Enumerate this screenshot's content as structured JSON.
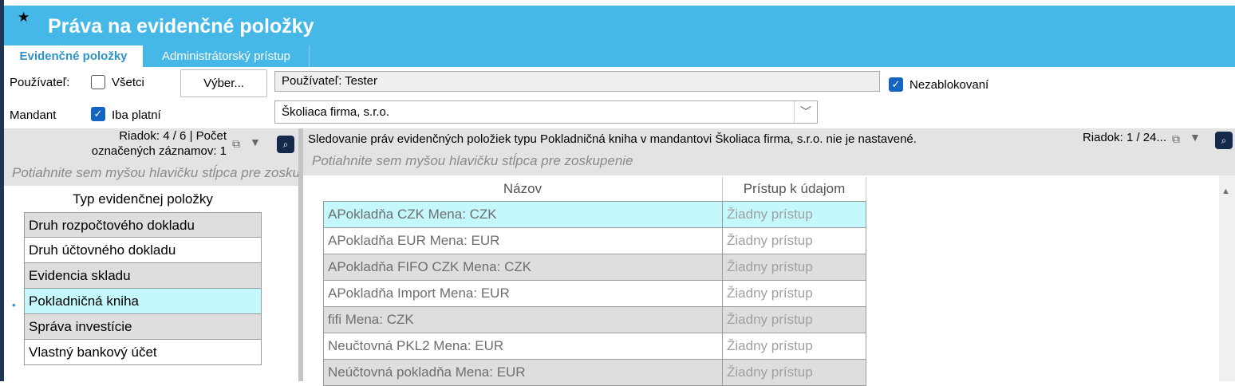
{
  "window": {
    "star": "★",
    "title": "Práva na evidenčné položky",
    "tabs": [
      "Evidenčné položky",
      "Administrátorský prístup"
    ]
  },
  "form": {
    "user_label": "Používateľ:",
    "all_label": "Všetci",
    "all_checked": false,
    "select_button": "Výber...",
    "user_value": "Používateľ: Tester",
    "unblocked_label": "Nezablokovaní",
    "unblocked_checked": true,
    "mandant_label": "Mandant",
    "only_valid_label": "Iba platní",
    "only_valid_checked": true,
    "mandant_value": "Školiaca firma, s.r.o.",
    "dropdown_glyph": "﹀"
  },
  "left_panel": {
    "row_info_line1": "Riadok: 4 / 6 | Počet",
    "row_info_line2": "označených záznamov: 1",
    "group_hint": "Potiahnite sem myšou hlavičku stĺpca pre zoskupenie",
    "column_header": "Typ evidenčnej položky",
    "rows": [
      {
        "label": "Druh rozpočtového dokladu",
        "state": "alt"
      },
      {
        "label": "Druh účtovného dokladu",
        "state": "normal"
      },
      {
        "label": "Evidencia skladu",
        "state": "alt"
      },
      {
        "label": "Pokladničná kniha",
        "state": "selected"
      },
      {
        "label": "Správa investície",
        "state": "alt"
      },
      {
        "label": "Vlastný bankový účet",
        "state": "normal"
      }
    ],
    "current_marker": "•"
  },
  "right_panel": {
    "message": "Sledovanie práv evidenčných položiek typu Pokladničná kniha v mandantovi Školiaca firma, s.r.o. nie je nastavené.",
    "row_info": "Riadok: 1 / 24...",
    "group_hint": "Potiahnite sem myšou hlavičku stĺpca pre zoskupenie",
    "columns": [
      "Názov",
      "Prístup k údajom"
    ],
    "rows": [
      {
        "name": "APokladňa CZK Mena: CZK",
        "access": "Žiadny prístup",
        "state": "selected"
      },
      {
        "name": "APokladňa EUR Mena: EUR",
        "access": "Žiadny prístup",
        "state": "normal"
      },
      {
        "name": "APokladňa FIFO CZK Mena: CZK",
        "access": "Žiadny prístup",
        "state": "alt"
      },
      {
        "name": "APokladňa Import Mena: EUR",
        "access": "Žiadny prístup",
        "state": "normal"
      },
      {
        "name": "fifi Mena: CZK",
        "access": "Žiadny prístup",
        "state": "alt"
      },
      {
        "name": "Neučtovná PKL2 Mena: EUR",
        "access": "Žiadny prístup",
        "state": "normal"
      },
      {
        "name": "Neúčtovná pokladňa Mena: EUR",
        "access": "Žiadny prístup",
        "state": "alt"
      }
    ]
  },
  "colors": {
    "header": "#46b8e8",
    "tab_active_text": "#2e93c9",
    "checkbox": "#1565c0",
    "selection": "#c4f8fc",
    "alt_row": "#dedede"
  },
  "icons": [
    "star-icon",
    "export-icon",
    "filter-icon",
    "search-lens-icon",
    "chevron-down-icon",
    "scroll-up-icon"
  ]
}
